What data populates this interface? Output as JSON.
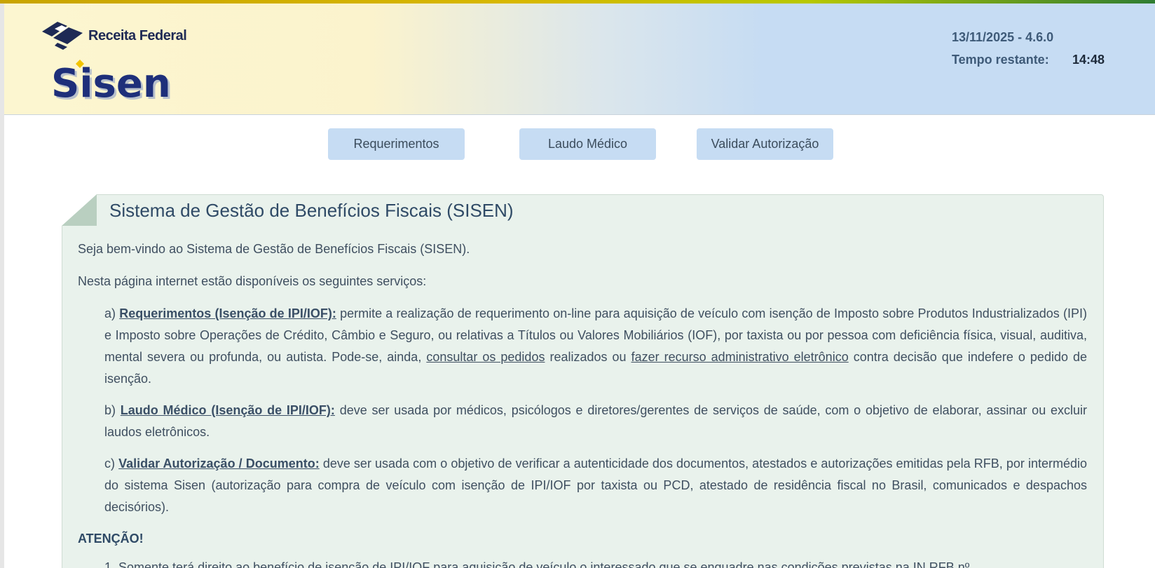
{
  "header": {
    "brand": "Receita Federal",
    "app_name": "Sisen",
    "version": "13/11/2025 - 4.6.0",
    "timer_label": "Tempo restante:",
    "timer_value": "14:48",
    "logo_icon": "receita-federal-logo"
  },
  "nav": {
    "requerimentos": "Requerimentos",
    "laudo": "Laudo Médico",
    "validar": "Validar Autorização"
  },
  "panel": {
    "title": "Sistema de Gestão de Benefícios Fiscais (SISEN)",
    "welcome": "Seja bem-vindo ao Sistema de Gestão de Benefícios Fiscais (SISEN).",
    "services_intro": "Nesta página internet estão disponíveis os seguintes serviços:",
    "services": [
      {
        "prefix": "a) ",
        "title": "Requerimentos (Isenção de IPI/IOF):",
        "text1": " permite a realização de requerimento on-line para aquisição de veículo com isenção de Imposto sobre Produtos Industrializados (IPI) e Imposto sobre Operações de Crédito, Câmbio e Seguro, ou relativas a Títulos ou Valores Mobiliários (IOF), por taxista ou por pessoa com deficiência física, visual, auditiva, mental severa ou profunda, ou autista. Pode-se, ainda, ",
        "link1": "consultar os pedidos",
        "text2": " realizados ou ",
        "link2": "fazer recurso administrativo eletrônico",
        "text3": " contra decisão que indefere o pedido de isenção."
      },
      {
        "prefix": "b) ",
        "title": "Laudo Médico (Isenção de IPI/IOF):",
        "text1": " deve ser usada por médicos, psicólogos e diretores/gerentes de serviços de saúde, com o objetivo de elaborar, assinar ou excluir laudos eletrônicos."
      },
      {
        "prefix": "c) ",
        "title": "Validar Autorização / Documento:",
        "text1": " deve ser usada com o objetivo de verificar a autenticidade dos documentos, atestados e autorizações emitidas pela RFB, por intermédio do sistema Sisen (autorização para compra de veículo com isenção de IPI/IOF por taxista ou PCD, atestado de residência fiscal no Brasil, comunicados e despachos decisórios)."
      }
    ],
    "attention_label": "ATENÇÃO!",
    "attention_item_1": "1. Somente terá direito ao benefício de isenção de IPI/IOF para aquisição de veículo o interessado que se enquadre nas condições previstas na IN RFB nº"
  },
  "colors": {
    "header_left": "#fbf3cd",
    "header_right": "#c6dcf3",
    "nav_button": "#c6dcf3",
    "panel_bg": "#e9f2ec",
    "title_text": "#2f4a66"
  }
}
